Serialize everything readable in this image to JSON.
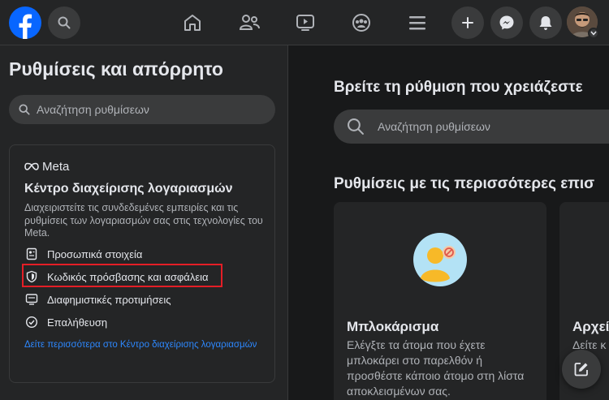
{
  "topbar": {
    "icons": [
      "facebook-logo",
      "search-icon",
      "home-icon",
      "friends-icon",
      "video-icon",
      "groups-icon",
      "menu-icon",
      "plus-icon",
      "messenger-icon",
      "bell-icon",
      "avatar"
    ]
  },
  "sidebar": {
    "title": "Ρυθμίσεις και απόρρητο",
    "search_placeholder": "Αναζήτηση ρυθμίσεων",
    "meta_card": {
      "logo_text": "Meta",
      "title": "Κέντρο διαχείρισης λογαριασμών",
      "description": "Διαχειριστείτε τις συνδεδεμένες εμπειρίες και τις ρυθμίσεις των λογαριασμών σας στις τεχνολογίες του Meta.",
      "items": [
        {
          "label": "Προσωπικά στοιχεία",
          "icon": "id-card-icon"
        },
        {
          "label": "Κωδικός πρόσβασης και ασφάλεια",
          "icon": "shield-icon",
          "highlighted": true
        },
        {
          "label": "Διαφημιστικές προτιμήσεις",
          "icon": "monitor-icon"
        },
        {
          "label": "Επαλήθευση",
          "icon": "check-circle-icon"
        }
      ],
      "link": "Δείτε περισσότερα στο Κέντρο διαχείρισης λογαριασμών"
    }
  },
  "main": {
    "heading": "Βρείτε τη ρύθμιση που χρειάζεστε",
    "search_placeholder": "Αναζήτηση ρυθμίσεων",
    "section_heading": "Ρυθμίσεις με τις περισσότερες επισ",
    "tiles": [
      {
        "title": "Μπλοκάρισμα",
        "description": "Ελέγξτε τα άτομα που έχετε μπλοκάρει στο παρελθόν ή προσθέστε κάποιο άτομο στη λίστα αποκλεισμένων σας."
      },
      {
        "title": "Αρχεί",
        "description": "Δείτε κ"
      }
    ]
  },
  "colors": {
    "brand": "#0866ff",
    "link": "#2d88ff",
    "highlight_border": "#e41e26",
    "background": "#18191a",
    "surface": "#242526"
  }
}
